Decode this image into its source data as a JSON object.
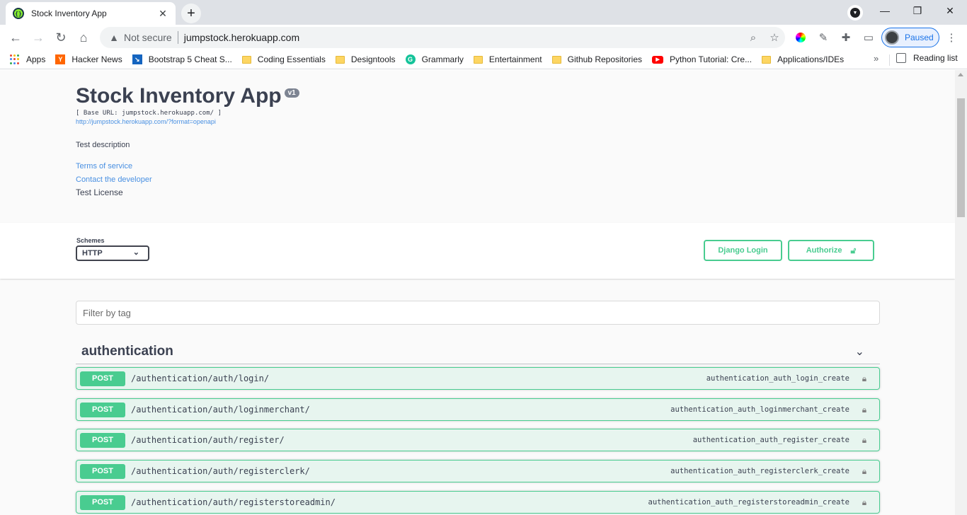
{
  "browser": {
    "tab_title": "Stock Inventory App",
    "security_label": "Not secure",
    "url": "jumpstock.herokuapp.com",
    "profile_status": "Paused",
    "bookmarks": [
      {
        "label": "Apps",
        "icon": "apps-grid-icon"
      },
      {
        "label": "Hacker News",
        "icon": "hacker-news-icon"
      },
      {
        "label": "Bootstrap 5 Cheat S...",
        "icon": "bootstrap-icon"
      },
      {
        "label": "Coding Essentials",
        "icon": "folder-icon"
      },
      {
        "label": "Designtools",
        "icon": "folder-icon"
      },
      {
        "label": "Grammarly",
        "icon": "grammarly-icon"
      },
      {
        "label": "Entertainment",
        "icon": "folder-icon"
      },
      {
        "label": "Github Repositories",
        "icon": "folder-icon"
      },
      {
        "label": "Python Tutorial: Cre...",
        "icon": "youtube-icon"
      },
      {
        "label": "Applications/IDEs",
        "icon": "folder-icon"
      }
    ],
    "reading_list": "Reading list"
  },
  "info": {
    "title": "Stock Inventory App",
    "version": "v1",
    "base_url": "[ Base URL: jumpstock.herokuapp.com/ ]",
    "spec_link": "http://jumpstock.herokuapp.com/?format=openapi",
    "description": "Test description",
    "terms": "Terms of service",
    "contact": "Contact the developer",
    "license": "Test License"
  },
  "schemes": {
    "label": "Schemes",
    "selected": "HTTP"
  },
  "buttons": {
    "django_login": "Django Login",
    "authorize": "Authorize"
  },
  "filter": {
    "placeholder": "Filter by tag"
  },
  "tag": {
    "name": "authentication",
    "operations": [
      {
        "method": "POST",
        "path": "/authentication/auth/login/",
        "operation_id": "authentication_auth_login_create"
      },
      {
        "method": "POST",
        "path": "/authentication/auth/loginmerchant/",
        "operation_id": "authentication_auth_loginmerchant_create"
      },
      {
        "method": "POST",
        "path": "/authentication/auth/register/",
        "operation_id": "authentication_auth_register_create"
      },
      {
        "method": "POST",
        "path": "/authentication/auth/registerclerk/",
        "operation_id": "authentication_auth_registerclerk_create"
      },
      {
        "method": "POST",
        "path": "/authentication/auth/registerstoreadmin/",
        "operation_id": "authentication_auth_registerstoreadmin_create"
      }
    ]
  },
  "colors": {
    "post": "#49cc90",
    "link": "#4990e2",
    "text": "#3b4151"
  }
}
